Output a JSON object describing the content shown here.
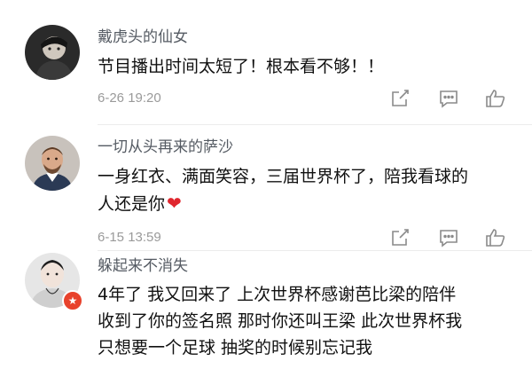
{
  "comments": [
    {
      "username": "戴虎头的仙女",
      "lines": [
        "节目播出时间太短了！根本看不够！！"
      ],
      "timestamp": "6-26 19:20",
      "icons": [
        "share-icon",
        "comment-icon",
        "like-icon"
      ]
    },
    {
      "username": "一切从头再来的萨沙",
      "lines": [
        "一身红衣、满面笑容，三届世界杯了，陪我看球的",
        "人还是你"
      ],
      "heart": "❤",
      "timestamp": "6-15 13:59",
      "icons": [
        "share-icon",
        "comment-icon",
        "like-icon"
      ]
    },
    {
      "username": "躲起来不消失",
      "lines": [
        "4年了 我又回来了 上次世界杯感谢芭比梁的陪伴",
        "收到了你的签名照 那时你还叫王梁 此次世界杯我",
        "只想要一个足球 抽奖的时候别忘记我"
      ],
      "badge_icon": "vip-star-icon"
    }
  ],
  "colors": {
    "username": "#555b63",
    "text": "#111111",
    "meta": "#9a9a9a",
    "heart": "#e0262e",
    "badge": "#e8422c"
  }
}
